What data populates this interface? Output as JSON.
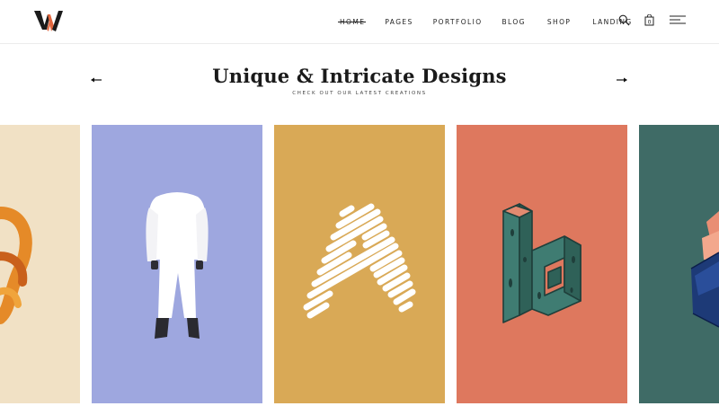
{
  "nav": {
    "items": [
      {
        "label": "Home",
        "active": true
      },
      {
        "label": "Pages"
      },
      {
        "label": "Portfolio"
      },
      {
        "label": "Blog"
      },
      {
        "label": "Shop"
      },
      {
        "label": "Landing"
      }
    ],
    "icons": [
      "search-icon",
      "shopping-bag-icon",
      "hamburger-menu-icon"
    ]
  },
  "section": {
    "title": "Unique & Intricate Designs",
    "subtitle": "Check out our latest creations"
  },
  "carousel": {
    "prev_icon": "arrow-left-icon",
    "next_icon": "arrow-right-icon",
    "cards": [
      {
        "image": "orange-ribbon-ampersand",
        "color": "#f1e1c5"
      },
      {
        "image": "white-outfit-figure",
        "color": "#9ea7df"
      },
      {
        "image": "striped-letter-a",
        "color": "#d9a956"
      },
      {
        "image": "isometric-letter-b",
        "color": "#de785e"
      },
      {
        "image": "geometric-shape",
        "color": "#3f6b66"
      }
    ]
  },
  "colors": {
    "logo_dark": "#1b1b1b",
    "logo_accent": "#e2673f",
    "text": "#1a1a1a"
  }
}
